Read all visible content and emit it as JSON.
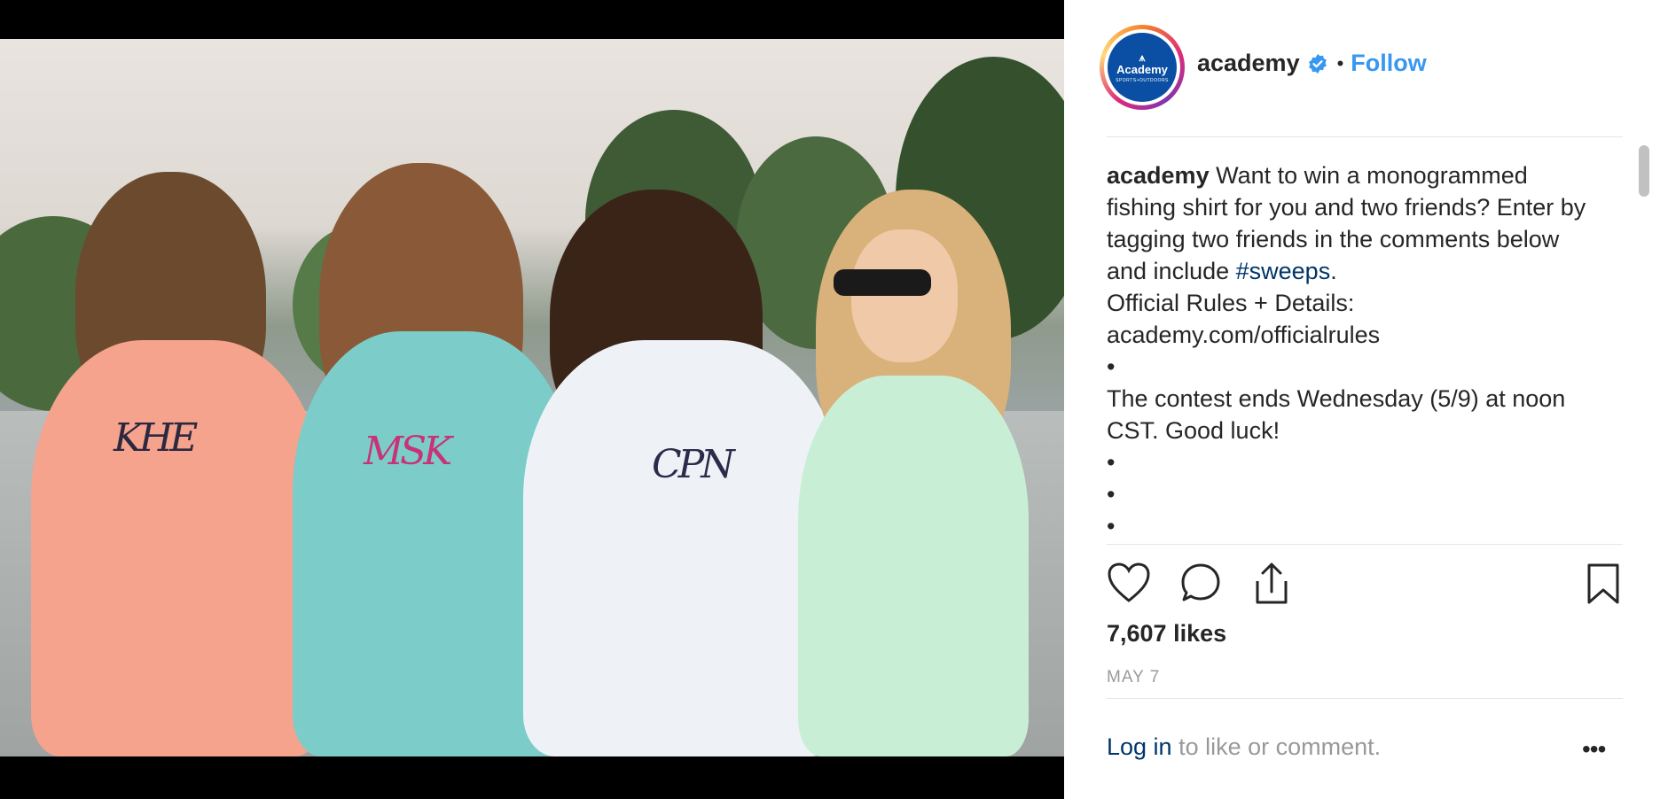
{
  "post": {
    "username": "academy",
    "follow_label": "Follow",
    "avatar": {
      "brand": "Academy",
      "subtext": "SPORTS+OUTDOORS"
    },
    "caption": {
      "username": "academy",
      "text_before_tag": " Want to win a monogrammed fishing shirt for you and two friends? Enter by tagging two friends in the comments below and include ",
      "hashtag": "#sweeps",
      "text_after_tag": ".",
      "rules_line": "Official Rules + Details: academy.com/officialrules",
      "bullet": "•",
      "contest_line": "The contest ends Wednesday (5/9) at noon CST. Good luck!"
    },
    "likes": "7,607 likes",
    "date": "MAY 7",
    "login_link": "Log in",
    "login_suffix": " to like or comment.",
    "more_label": "•••"
  },
  "photo": {
    "monograms": [
      "KHE",
      "MSK",
      "CPN"
    ]
  },
  "icons": {
    "like": "heart-icon",
    "comment": "comment-icon",
    "share": "share-icon",
    "save": "bookmark-icon",
    "verified": "verified-badge-icon"
  },
  "colors": {
    "follow": "#3897f0",
    "hashtag": "#003569",
    "avatar_bg": "#0a4fa3",
    "text": "#262626",
    "muted": "#999999"
  }
}
